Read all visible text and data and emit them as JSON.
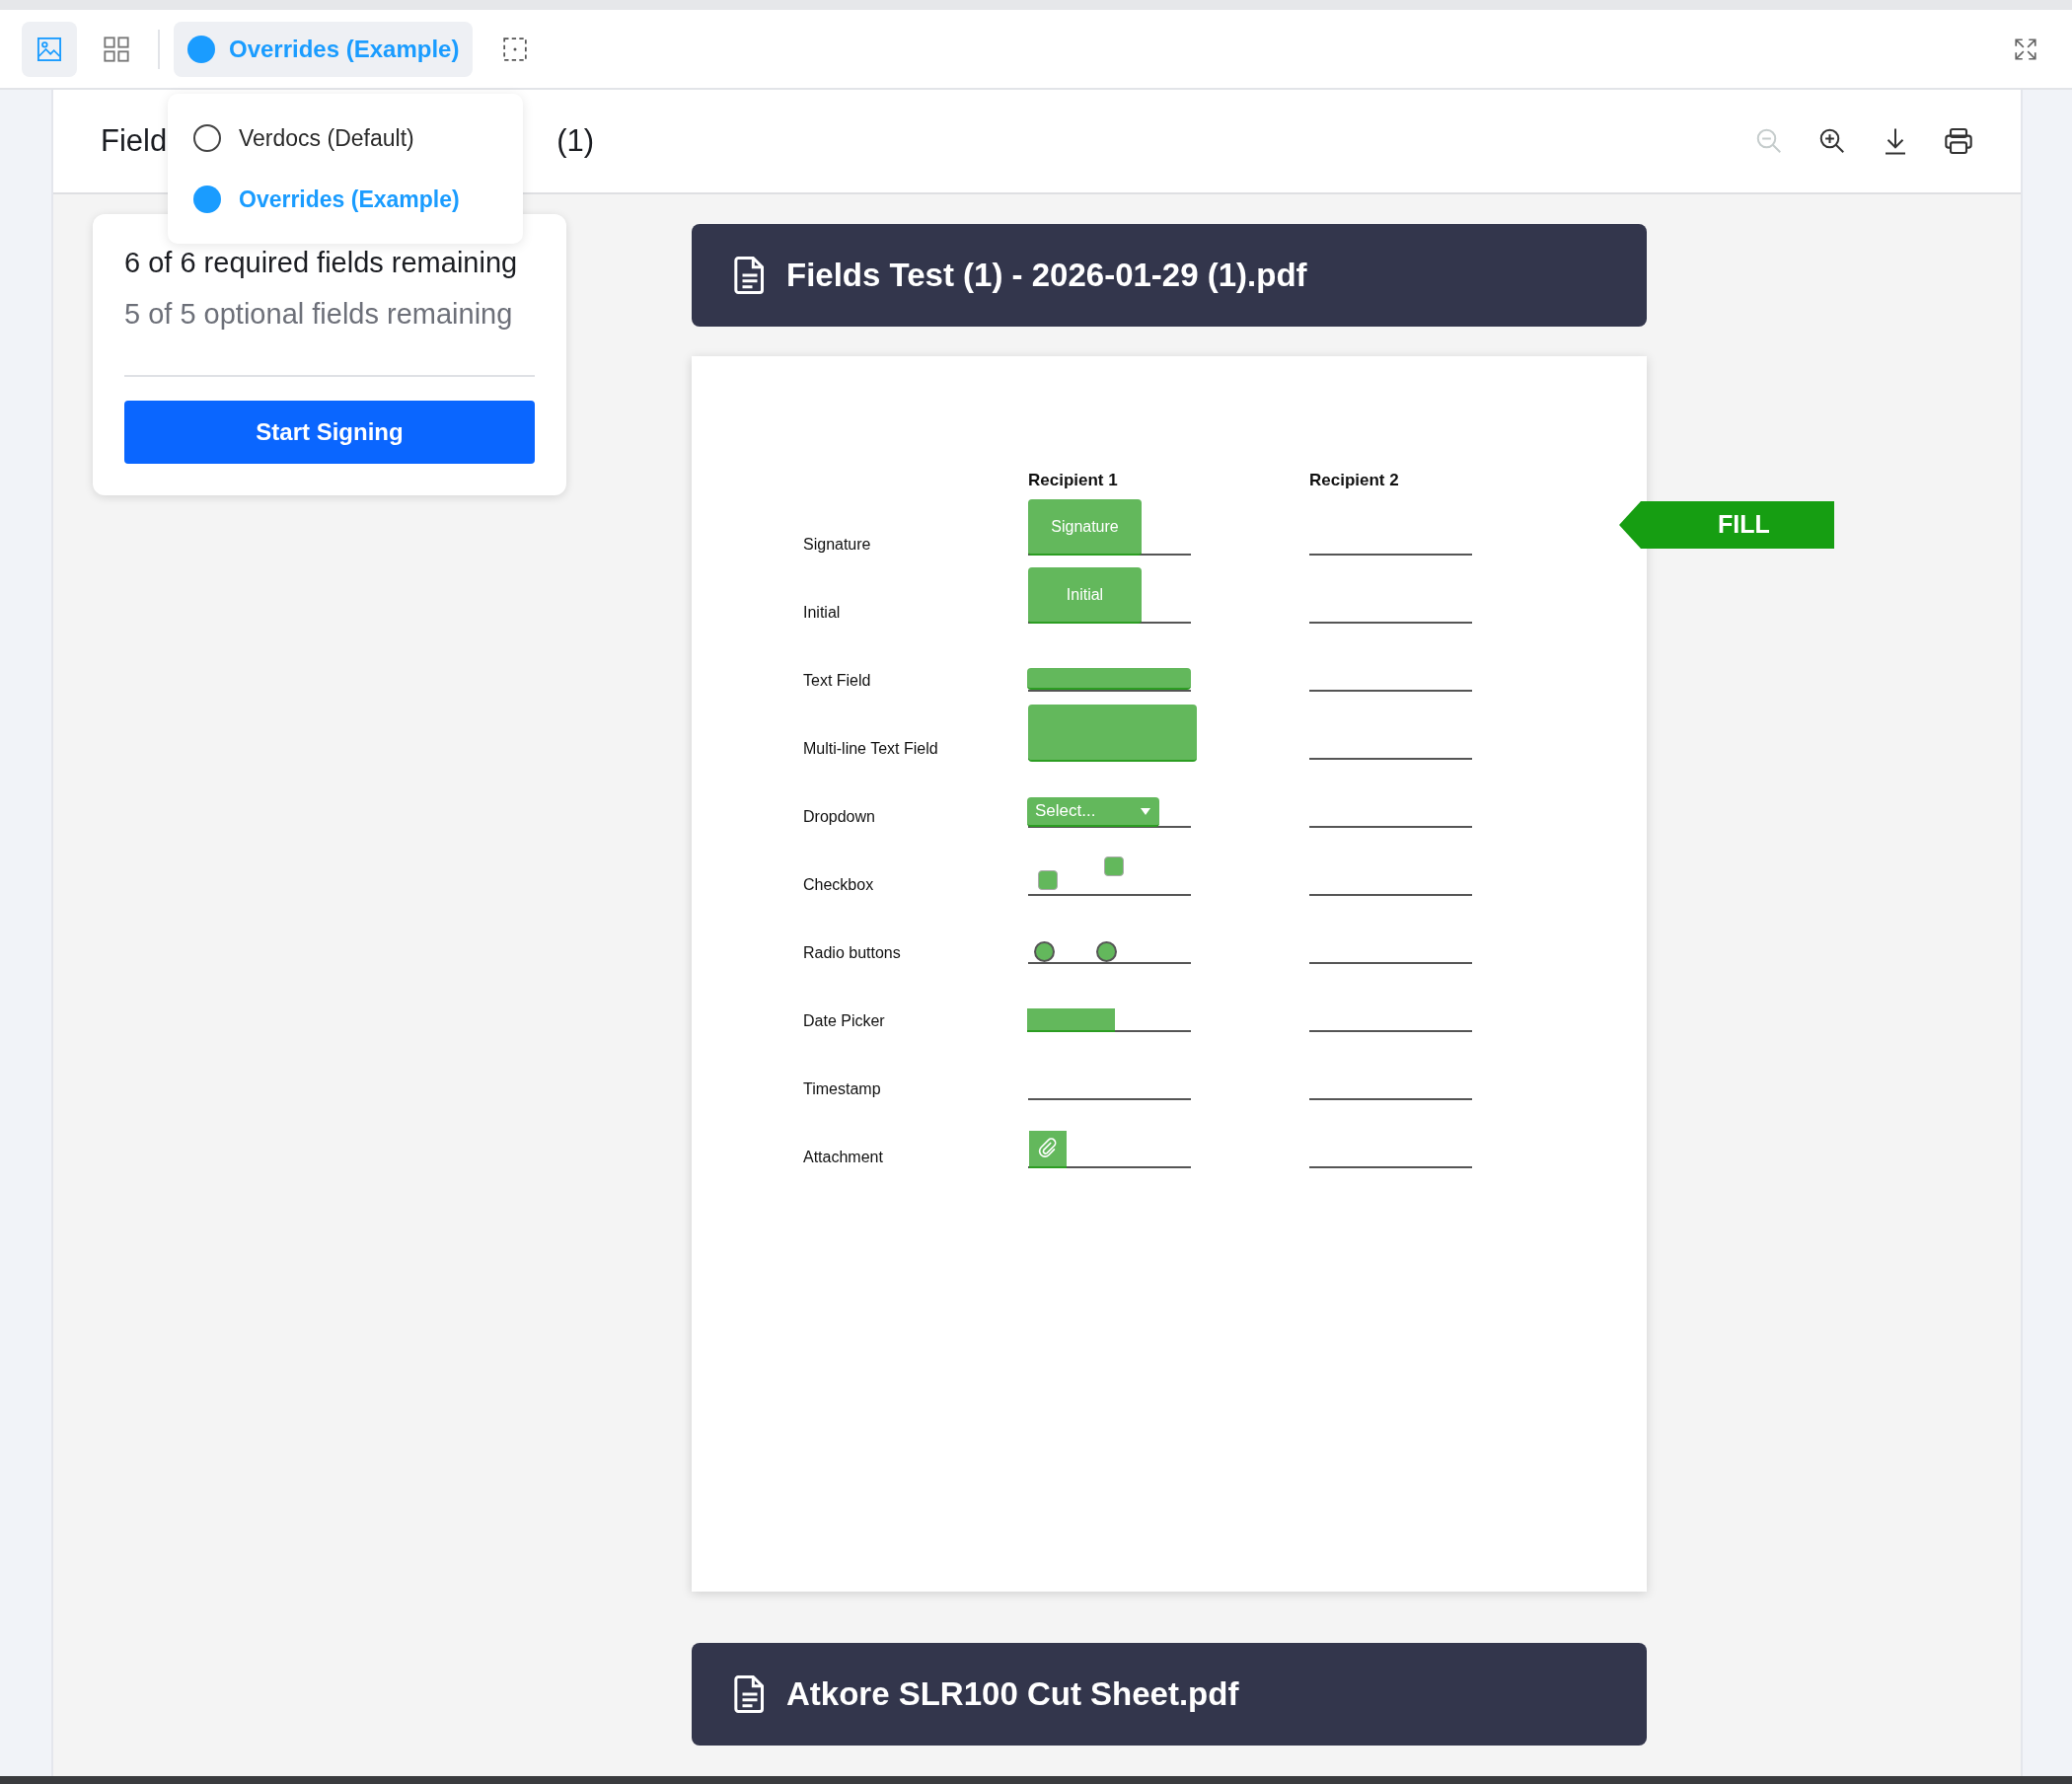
{
  "toolbar": {
    "view_buttons": [
      {
        "kind": "image",
        "selected": true
      },
      {
        "kind": "grid",
        "selected": false
      }
    ],
    "theme_button": {
      "label": "Overrides (Example)",
      "color": "#1a9cff"
    },
    "theme_menu": [
      {
        "label": "Verdocs (Default)",
        "selected": false
      },
      {
        "label": "Overrides (Example)",
        "selected": true
      }
    ]
  },
  "header": {
    "title_parts": [
      "Field",
      "(1)"
    ],
    "zoom_out_disabled": true
  },
  "summary": {
    "required": "6 of 6 required fields remaining",
    "optional": "5 of 5 optional fields remaining",
    "button": "Start Signing"
  },
  "documents": [
    {
      "title": "Fields Test (1) - 2026-01-29 (1).pdf",
      "page": {
        "columns": [
          "Recipient 1",
          "Recipient 2"
        ],
        "fill_label": "FILL",
        "rows": [
          {
            "label": "Signature",
            "field": {
              "kind": "signature",
              "text": "Signature"
            }
          },
          {
            "label": "Initial",
            "field": {
              "kind": "initial",
              "text": "Initial"
            }
          },
          {
            "label": "Text Field",
            "field": {
              "kind": "text"
            }
          },
          {
            "label": "Multi-line Text Field",
            "field": {
              "kind": "multiline"
            }
          },
          {
            "label": "Dropdown",
            "field": {
              "kind": "dropdown",
              "text": "Select..."
            }
          },
          {
            "label": "Checkbox",
            "field": {
              "kind": "checkbox",
              "options": [
                {
                  "checked": false
                },
                {
                  "checked": false
                }
              ]
            }
          },
          {
            "label": "Radio buttons",
            "field": {
              "kind": "radio",
              "options": [
                {
                  "checked": false
                },
                {
                  "checked": false
                }
              ]
            }
          },
          {
            "label": "Date Picker",
            "field": {
              "kind": "date"
            }
          },
          {
            "label": "Timestamp",
            "field": {
              "kind": "none"
            }
          },
          {
            "label": "Attachment",
            "field": {
              "kind": "attachment"
            }
          }
        ]
      }
    },
    {
      "title": "Atkore SLR100 Cut Sheet.pdf"
    }
  ]
}
